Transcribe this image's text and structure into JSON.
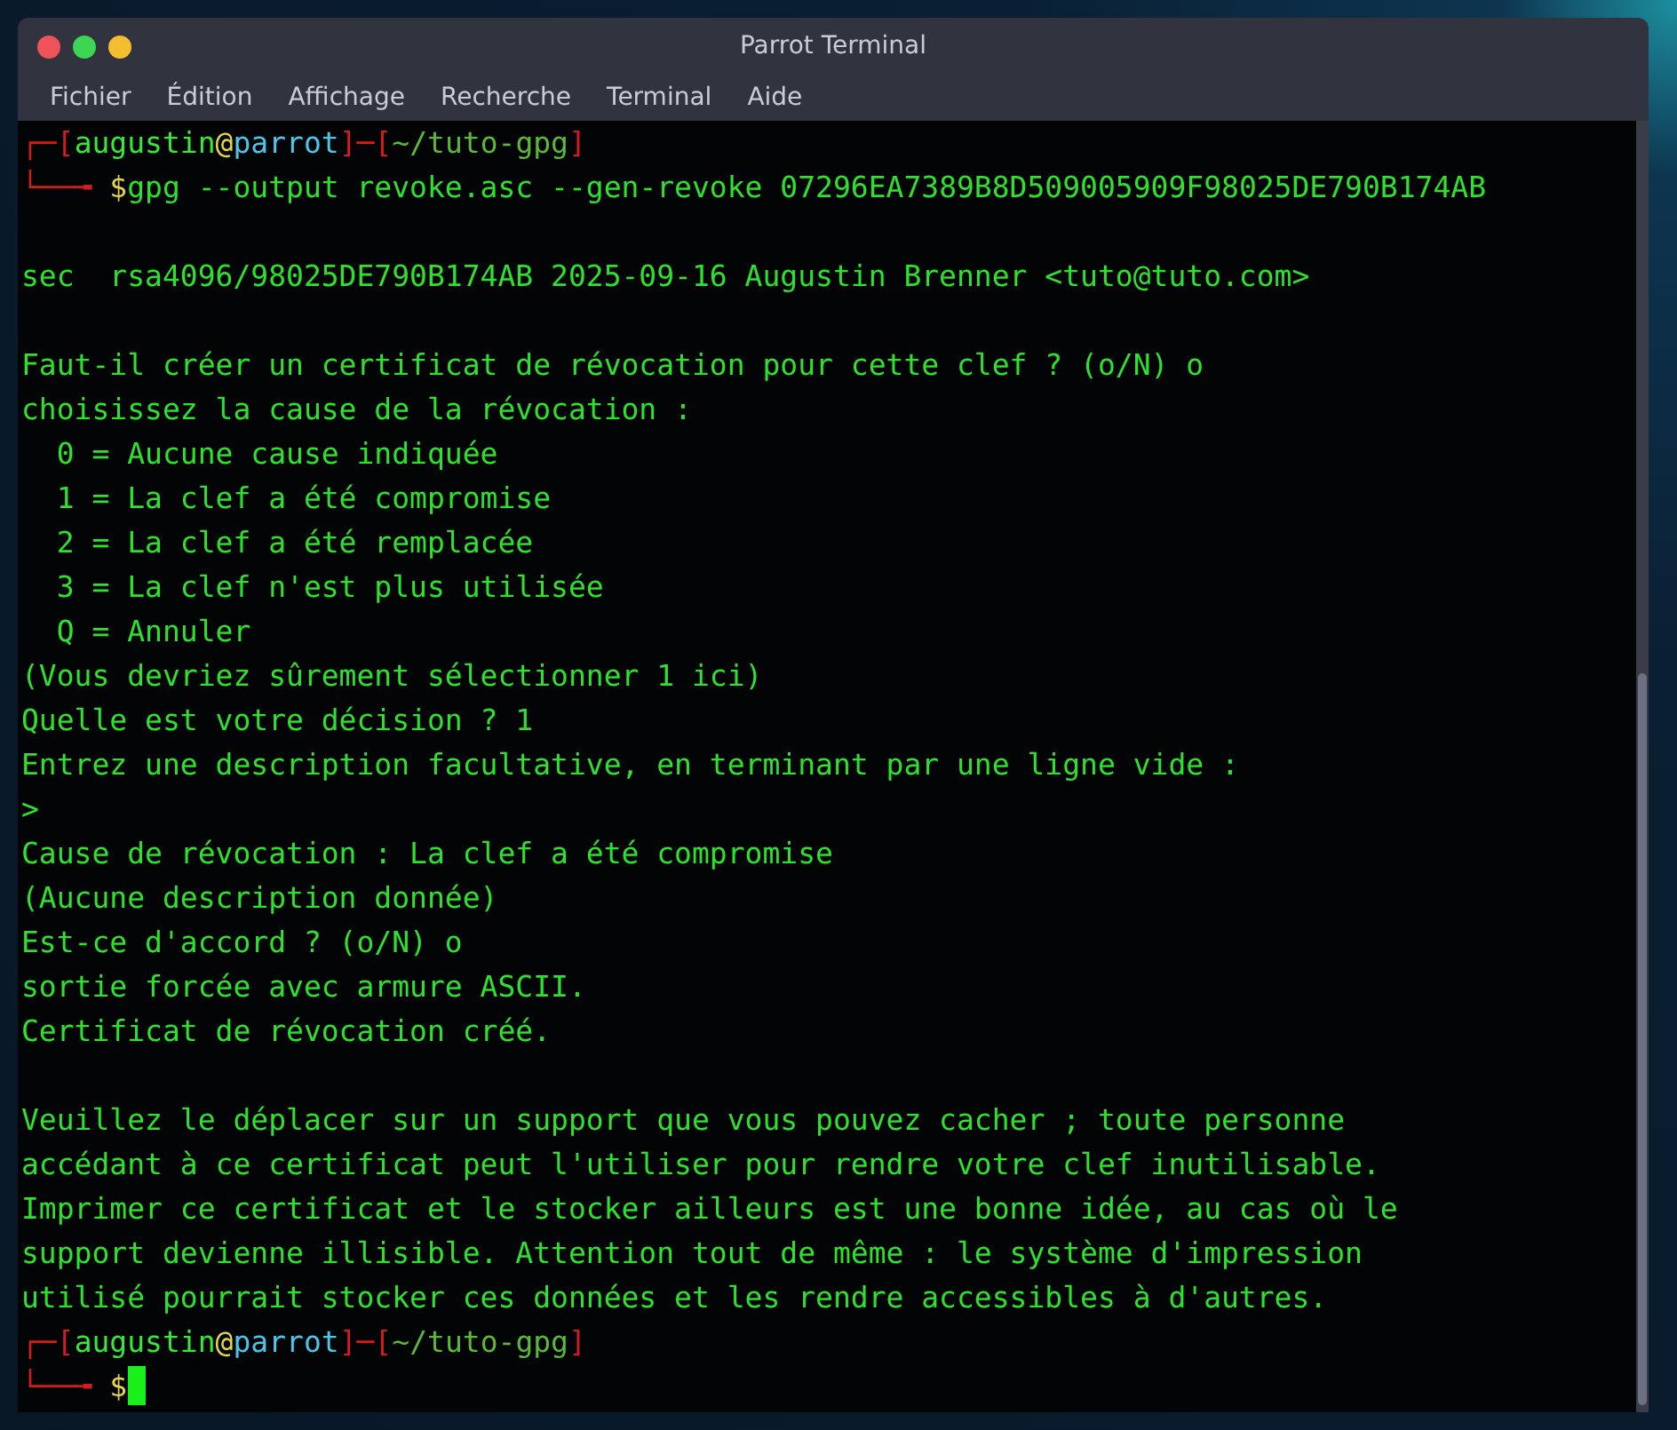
{
  "window": {
    "title": "Parrot Terminal"
  },
  "menu": [
    "Fichier",
    "Édition",
    "Affichage",
    "Recherche",
    "Terminal",
    "Aide"
  ],
  "terminal": {
    "lines": [
      {
        "kind": "prompt",
        "header": [
          {
            "kind": "frame",
            "text": "┌─["
          },
          {
            "kind": "user",
            "text": "augustin"
          },
          {
            "kind": "at",
            "text": "@"
          },
          {
            "kind": "host",
            "text": "parrot"
          },
          {
            "kind": "frame",
            "text": "]─["
          },
          {
            "kind": "path",
            "text": "~/tuto-gpg"
          },
          {
            "kind": "frame",
            "text": "]"
          }
        ],
        "corner": "└──╼ ",
        "sign": "$",
        "command": "gpg --output revoke.asc --gen-revoke 07296EA7389B8D509005909F98025DE790B174AB",
        "cursor": false
      },
      {
        "kind": "blank"
      },
      {
        "kind": "output",
        "text": "sec  rsa4096/98025DE790B174AB 2025-09-16 Augustin Brenner <tuto@tuto.com>"
      },
      {
        "kind": "blank"
      },
      {
        "kind": "output",
        "text": "Faut-il créer un certificat de révocation pour cette clef ? (o/N) o"
      },
      {
        "kind": "output",
        "text": "choisissez la cause de la révocation :"
      },
      {
        "kind": "output",
        "text": "  0 = Aucune cause indiquée"
      },
      {
        "kind": "output",
        "text": "  1 = La clef a été compromise"
      },
      {
        "kind": "output",
        "text": "  2 = La clef a été remplacée"
      },
      {
        "kind": "output",
        "text": "  3 = La clef n'est plus utilisée"
      },
      {
        "kind": "output",
        "text": "  Q = Annuler"
      },
      {
        "kind": "output",
        "text": "(Vous devriez sûrement sélectionner 1 ici)"
      },
      {
        "kind": "output",
        "text": "Quelle est votre décision ? 1"
      },
      {
        "kind": "output",
        "text": "Entrez une description facultative, en terminant par une ligne vide :"
      },
      {
        "kind": "output",
        "text": ">"
      },
      {
        "kind": "output",
        "text": "Cause de révocation : La clef a été compromise"
      },
      {
        "kind": "output",
        "text": "(Aucune description donnée)"
      },
      {
        "kind": "output",
        "text": "Est-ce d'accord ? (o/N) o"
      },
      {
        "kind": "output",
        "text": "sortie forcée avec armure ASCII."
      },
      {
        "kind": "output",
        "text": "Certificat de révocation créé."
      },
      {
        "kind": "blank"
      },
      {
        "kind": "output",
        "text": "Veuillez le déplacer sur un support que vous pouvez cacher ; toute personne"
      },
      {
        "kind": "output",
        "text": "accédant à ce certificat peut l'utiliser pour rendre votre clef inutilisable."
      },
      {
        "kind": "output",
        "text": "Imprimer ce certificat et le stocker ailleurs est une bonne idée, au cas où le"
      },
      {
        "kind": "output",
        "text": "support devienne illisible. Attention tout de même : le système d'impression"
      },
      {
        "kind": "output",
        "text": "utilisé pourrait stocker ces données et les rendre accessibles à d'autres."
      },
      {
        "kind": "prompt",
        "header": [
          {
            "kind": "frame",
            "text": "┌─["
          },
          {
            "kind": "user",
            "text": "augustin"
          },
          {
            "kind": "at",
            "text": "@"
          },
          {
            "kind": "host",
            "text": "parrot"
          },
          {
            "kind": "frame",
            "text": "]─["
          },
          {
            "kind": "path",
            "text": "~/tuto-gpg"
          },
          {
            "kind": "frame",
            "text": "]"
          }
        ],
        "corner": "└──╼ ",
        "sign": "$",
        "cursor": true
      }
    ]
  }
}
